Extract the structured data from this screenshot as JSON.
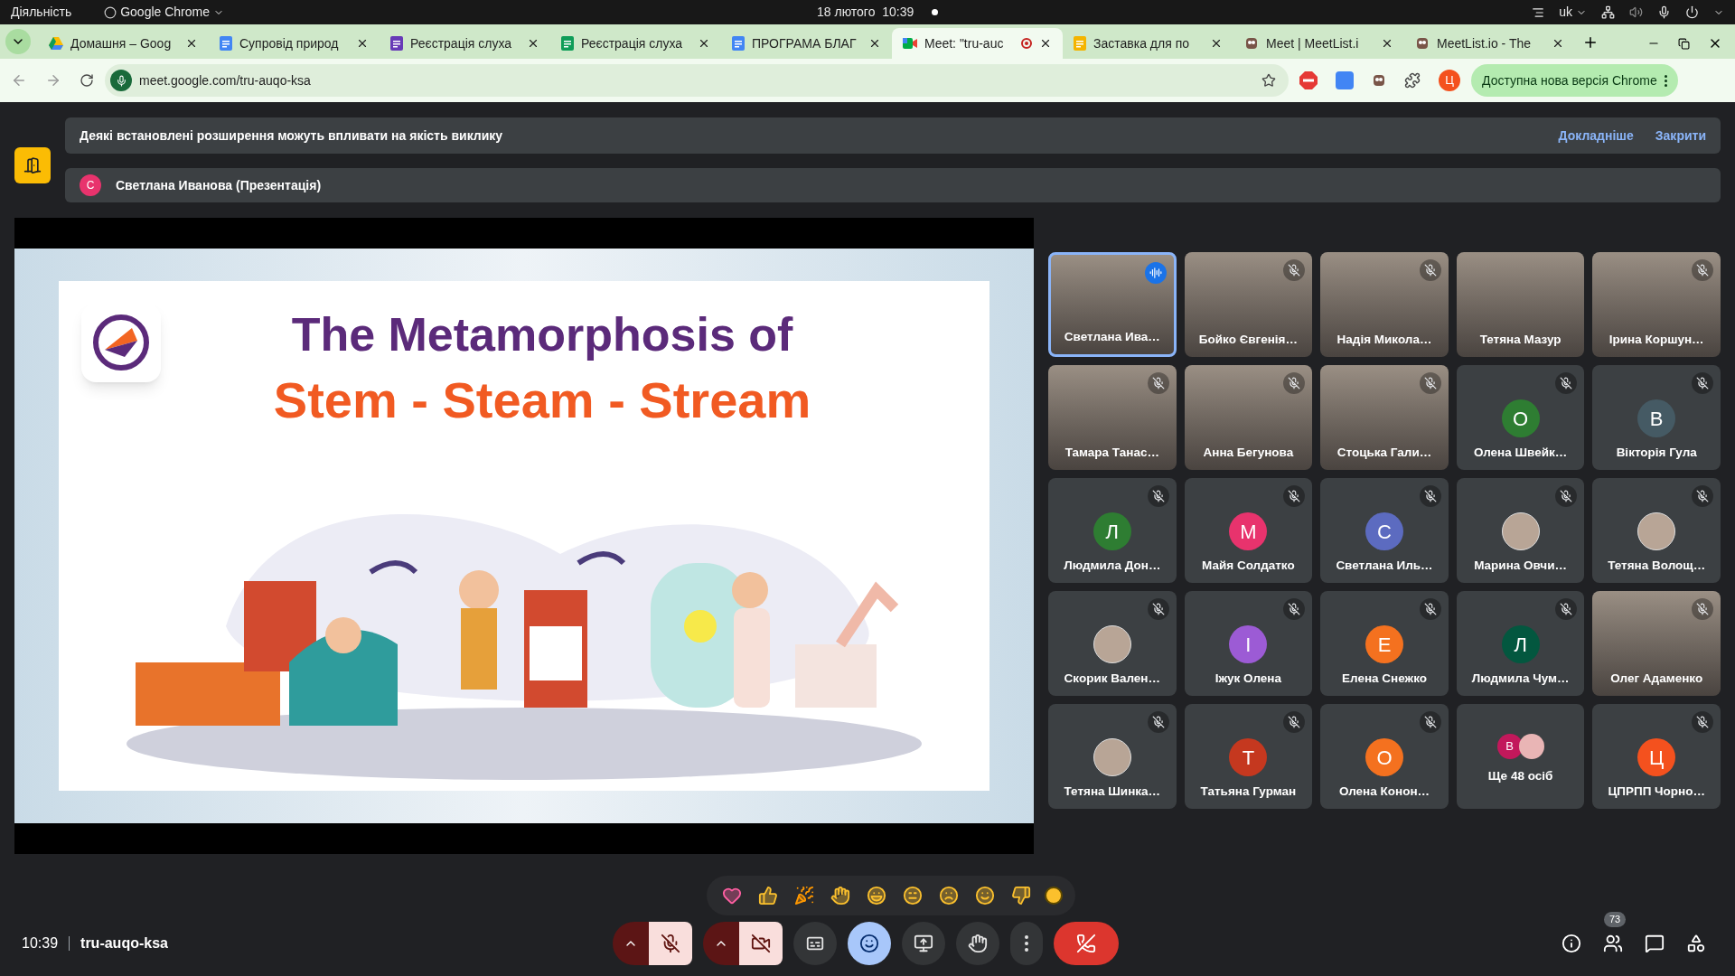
{
  "system_bar": {
    "activities": "Діяльність",
    "app": "Google Chrome",
    "clock": "18 лютого  10:39",
    "language": "uk"
  },
  "tabs": [
    {
      "title": "Домашня – Goog",
      "kind": "drive",
      "selected": false,
      "recording": false
    },
    {
      "title": "Супровід природ",
      "kind": "docs",
      "selected": false,
      "recording": false
    },
    {
      "title": "Реєстрація слуха",
      "kind": "forms",
      "selected": false,
      "recording": false
    },
    {
      "title": "Реєстрація слуха",
      "kind": "sheets",
      "selected": false,
      "recording": false
    },
    {
      "title": "ПРОГРАМА БЛАГ",
      "kind": "docs",
      "selected": false,
      "recording": false
    },
    {
      "title": "Meet: \"tru-auc",
      "kind": "meet",
      "selected": true,
      "recording": true
    },
    {
      "title": "Заставка для по",
      "kind": "slides",
      "selected": false,
      "recording": false
    },
    {
      "title": "Meet | MeetList.i",
      "kind": "owl",
      "selected": false,
      "recording": false
    },
    {
      "title": "MeetList.io - The",
      "kind": "owl",
      "selected": false,
      "recording": false
    }
  ],
  "address_bar": {
    "url": "meet.google.com/tru-auqo-ksa",
    "profile_letter": "Ц",
    "update_button": "Доступна нова версія Chrome"
  },
  "banner": {
    "message": "Деякі встановлені розширення можуть впливати на якість виклику",
    "links": [
      "Докладніше",
      "Закрити"
    ]
  },
  "presenter_bar": {
    "initial": "С",
    "label": "Светлана Иванова (Презентація)"
  },
  "slide": {
    "title": "The Metamorphosis of",
    "subtitle": "Stem - Steam - Stream"
  },
  "participants": [
    {
      "name": "Светлана Ива…",
      "kind": "video",
      "muted": false,
      "speaking": true
    },
    {
      "name": "Бойко Євгенія…",
      "kind": "video",
      "muted": true,
      "speaking": false
    },
    {
      "name": "Надія Микола…",
      "kind": "video",
      "muted": true,
      "speaking": false
    },
    {
      "name": "Тетяна Мазур",
      "kind": "video",
      "muted": false,
      "speaking": false
    },
    {
      "name": "Ірина Коршун…",
      "kind": "video",
      "muted": true,
      "speaking": false
    },
    {
      "name": "Тамара Танас…",
      "kind": "video",
      "muted": true,
      "speaking": false
    },
    {
      "name": "Анна Бегунова",
      "kind": "video",
      "muted": true,
      "speaking": false
    },
    {
      "name": "Стоцька Гали…",
      "kind": "video",
      "muted": true,
      "speaking": false
    },
    {
      "name": "Олена Швейк…",
      "kind": "letter",
      "initial": "О",
      "color": "#2e7d32",
      "muted": true,
      "speaking": false
    },
    {
      "name": "Вікторія Гула",
      "kind": "letter",
      "initial": "В",
      "color": "#455a64",
      "muted": true,
      "speaking": false
    },
    {
      "name": "Людмила Дон…",
      "kind": "letter",
      "initial": "Л",
      "color": "#2e7d32",
      "muted": true,
      "speaking": false
    },
    {
      "name": "Майя Солдатко",
      "kind": "letter",
      "initial": "М",
      "color": "#e8336d",
      "muted": true,
      "speaking": false
    },
    {
      "name": "Светлана Иль…",
      "kind": "letter",
      "initial": "С",
      "color": "#5c6bc0",
      "muted": true,
      "speaking": false
    },
    {
      "name": "Марина Овчи…",
      "kind": "photo",
      "muted": true,
      "speaking": false
    },
    {
      "name": "Тетяна Волощ…",
      "kind": "photo",
      "muted": true,
      "speaking": false
    },
    {
      "name": "Скорик Вален…",
      "kind": "photo",
      "muted": true,
      "speaking": false
    },
    {
      "name": "Іжук Олена",
      "kind": "letter",
      "initial": "І",
      "color": "#9c5bd5",
      "muted": true,
      "speaking": false
    },
    {
      "name": "Елена Снежко",
      "kind": "letter",
      "initial": "Е",
      "color": "#f4711f",
      "muted": true,
      "speaking": false
    },
    {
      "name": "Людмила Чум…",
      "kind": "letter",
      "initial": "Л",
      "color": "#03573f",
      "muted": true,
      "speaking": false
    },
    {
      "name": "Олег Адаменко",
      "kind": "video",
      "muted": true,
      "speaking": false
    },
    {
      "name": "Тетяна Шинка…",
      "kind": "photo",
      "muted": true,
      "speaking": false
    },
    {
      "name": "Татьяна Гурман",
      "kind": "letter",
      "initial": "Т",
      "color": "#c5381f",
      "muted": true,
      "speaking": false
    },
    {
      "name": "Олена Конон…",
      "kind": "letter",
      "initial": "О",
      "color": "#f4711f",
      "muted": true,
      "speaking": false
    },
    {
      "name": "Ще 48 осіб",
      "kind": "more",
      "initial": "В",
      "color": "#c2185b"
    },
    {
      "name": "ЦПРПП Чорно…",
      "kind": "letter",
      "initial": "Ц",
      "color": "#f4511e",
      "muted": true,
      "speaking": false
    }
  ],
  "reactions": [
    {
      "kind": "heart"
    },
    {
      "kind": "thumbs-up"
    },
    {
      "kind": "party"
    },
    {
      "kind": "clap"
    },
    {
      "kind": "laugh"
    },
    {
      "kind": "surprised"
    },
    {
      "kind": "sad"
    },
    {
      "kind": "thinking"
    },
    {
      "kind": "thumbs-down"
    },
    {
      "kind": "skin-tone"
    }
  ],
  "meeting": {
    "time": "10:39",
    "code": "tru-auqo-ksa",
    "participant_count": "73"
  },
  "controls": [
    {
      "kind": "mic",
      "on": false
    },
    {
      "kind": "camera",
      "on": false
    },
    {
      "kind": "captions",
      "on": false
    },
    {
      "kind": "reactions",
      "on": true
    },
    {
      "kind": "present",
      "on": false
    },
    {
      "kind": "hand",
      "on": false
    },
    {
      "kind": "more",
      "on": false
    },
    {
      "kind": "end-call",
      "on": false
    }
  ]
}
